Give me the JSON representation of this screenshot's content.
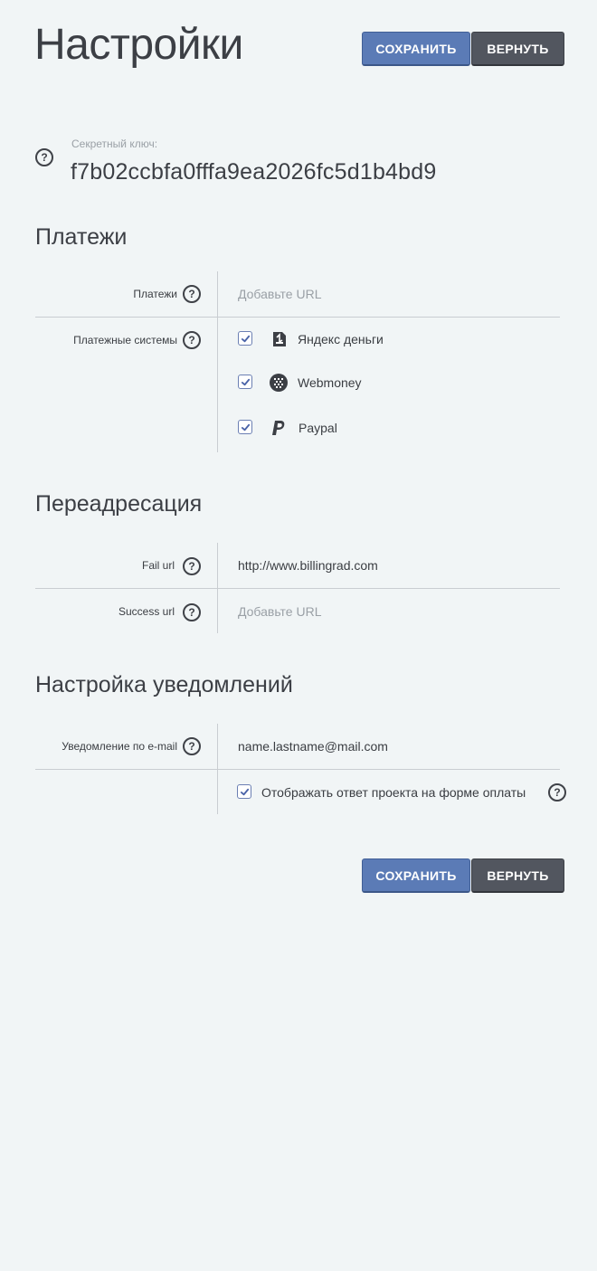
{
  "page": {
    "title": "Настройки",
    "save_label": "СОХРАНИТЬ",
    "revert_label": "ВЕРНУТЬ"
  },
  "secret": {
    "label": "Секретный ключ:",
    "value": "f7b02ccbfa0fffa9ea2026fc5d1b4bd9"
  },
  "payments": {
    "title": "Платежи",
    "url_label": "Платежи",
    "url_value": "",
    "url_placeholder": "Добавьте URL",
    "systems_label": "Платежные системы",
    "systems": [
      {
        "name": "Яндекс деньги",
        "icon": "yandex-money-icon",
        "checked": true
      },
      {
        "name": "Webmoney",
        "icon": "webmoney-icon",
        "checked": true
      },
      {
        "name": "Paypal",
        "icon": "paypal-icon",
        "checked": true
      }
    ]
  },
  "redirect": {
    "title": "Переадресация",
    "fail_label": "Fail url",
    "fail_value": "http://www.billingrad.com",
    "success_label": "Success url",
    "success_value": "",
    "success_placeholder": "Добавьте URL"
  },
  "notifications": {
    "title": "Настройка уведомлений",
    "email_label": "Уведомление по e-mail",
    "email_value": "name.lastname@mail.com",
    "show_answer_label": "Отображать ответ проекта на форме оплаты",
    "show_answer_checked": true
  },
  "help_glyph": "?",
  "colors": {
    "background": "#f1f5f6",
    "save_button": "#5b7bb6",
    "revert_button": "#52565f",
    "checkbox_border": "#6b7fb3"
  }
}
